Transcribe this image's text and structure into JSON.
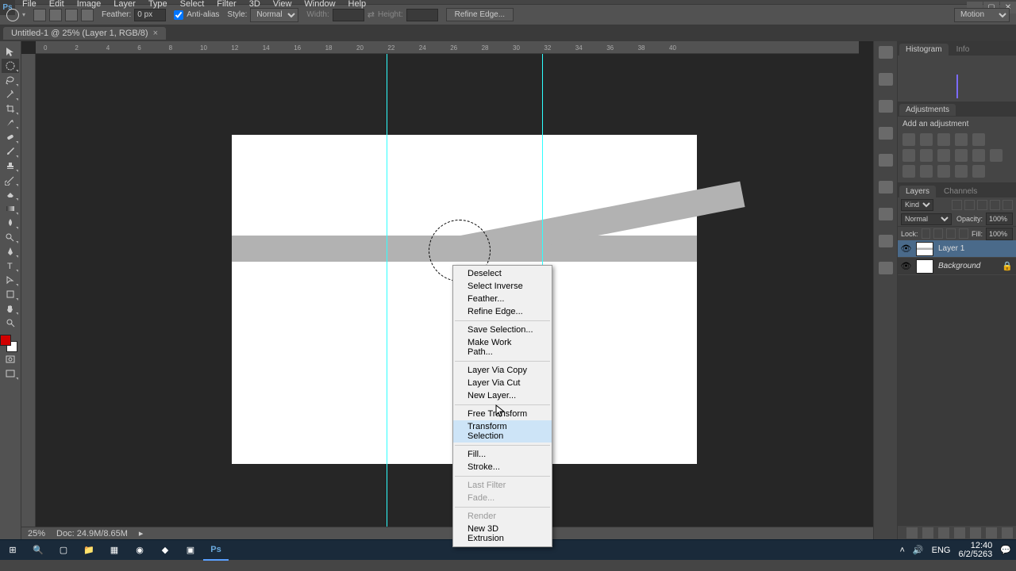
{
  "app": {
    "logo": "Ps"
  },
  "window_controls": {
    "min": "_",
    "max": "▢",
    "close": "✕"
  },
  "menu": [
    "File",
    "Edit",
    "Image",
    "Layer",
    "Type",
    "Select",
    "Filter",
    "3D",
    "View",
    "Window",
    "Help"
  ],
  "options_bar": {
    "feather_label": "Feather:",
    "feather_value": "0 px",
    "antialias_label": "Anti-alias",
    "style_label": "Style:",
    "style_value": "Normal",
    "width_label": "Width:",
    "height_label": "Height:",
    "refine_btn": "Refine Edge...",
    "workspace_select": "Motion"
  },
  "doc_tab": {
    "title": "Untitled-1 @ 25% (Layer 1, RGB/8)",
    "close": "×"
  },
  "ruler_marks": [
    "0",
    "2",
    "4",
    "6",
    "8",
    "10",
    "12",
    "14",
    "16",
    "18",
    "20",
    "22",
    "24",
    "26",
    "28",
    "30",
    "32",
    "34",
    "36",
    "38",
    "40"
  ],
  "status": {
    "zoom": "25%",
    "doc": "Doc: 24.9M/8.65M"
  },
  "panels": {
    "histogram_tab": "Histogram",
    "info_tab": "Info",
    "adjustments_tab": "Adjustments",
    "adjustments_header": "Add an adjustment",
    "layers_tab": "Layers",
    "channels_tab": "Channels",
    "kind_label": "Kind",
    "blend_mode": "Normal",
    "opacity_label": "Opacity:",
    "opacity_value": "100%",
    "lock_label": "Lock:",
    "fill_label": "Fill:",
    "fill_value": "100%",
    "layer1": "Layer 1",
    "background": "Background"
  },
  "context_menu": {
    "items": [
      {
        "label": "Deselect",
        "type": "item"
      },
      {
        "label": "Select Inverse",
        "type": "item"
      },
      {
        "label": "Feather...",
        "type": "item"
      },
      {
        "label": "Refine Edge...",
        "type": "item"
      },
      {
        "type": "sep"
      },
      {
        "label": "Save Selection...",
        "type": "item"
      },
      {
        "label": "Make Work Path...",
        "type": "item"
      },
      {
        "type": "sep"
      },
      {
        "label": "Layer Via Copy",
        "type": "item"
      },
      {
        "label": "Layer Via Cut",
        "type": "item"
      },
      {
        "label": "New Layer...",
        "type": "item"
      },
      {
        "type": "sep"
      },
      {
        "label": "Free Transform",
        "type": "item"
      },
      {
        "label": "Transform Selection",
        "type": "item",
        "hover": true
      },
      {
        "type": "sep"
      },
      {
        "label": "Fill...",
        "type": "item"
      },
      {
        "label": "Stroke...",
        "type": "item"
      },
      {
        "type": "sep"
      },
      {
        "label": "Last Filter",
        "type": "disabled"
      },
      {
        "label": "Fade...",
        "type": "disabled"
      },
      {
        "type": "sep"
      },
      {
        "label": "Render",
        "type": "disabled"
      },
      {
        "label": "New 3D Extrusion",
        "type": "item"
      }
    ]
  },
  "taskbar": {
    "time": "12:40",
    "date": "6/2/5263",
    "lang": "ENG"
  }
}
